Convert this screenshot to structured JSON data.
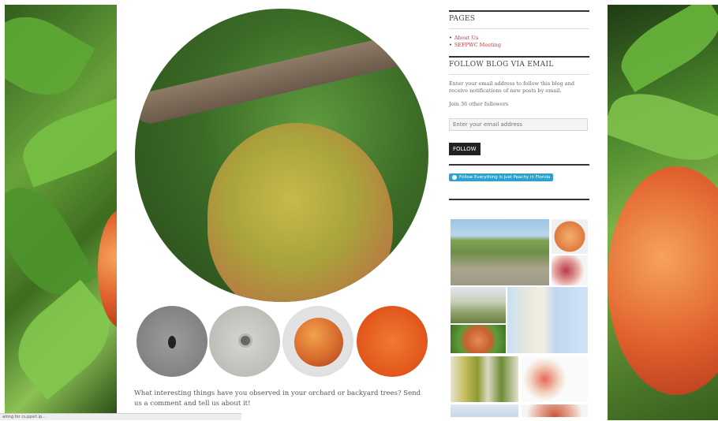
{
  "sidebar": {
    "pages": {
      "title": "PAGES",
      "links": [
        "About Us",
        "SEFPWC Meeting"
      ]
    },
    "follow": {
      "title": "FOLLOW BLOG VIA EMAIL",
      "description": "Enter your email address to follow this blog and receive notifications of new posts by email.",
      "followers": "Join 36 other followers",
      "email_placeholder": "Enter your email address",
      "button": "FOLLOW",
      "badge": "Follow Everything is Just Peachy in Florida"
    }
  },
  "main": {
    "caption": "What interesting things have you observed in your orchard or backyard trees? Send us a comment and tell us about it!"
  },
  "status_bar": "aiting for cs.ppsrt.ip...",
  "colors": {
    "link": "#cc3333",
    "button": "#222222",
    "badge": "#2ea2cc"
  }
}
